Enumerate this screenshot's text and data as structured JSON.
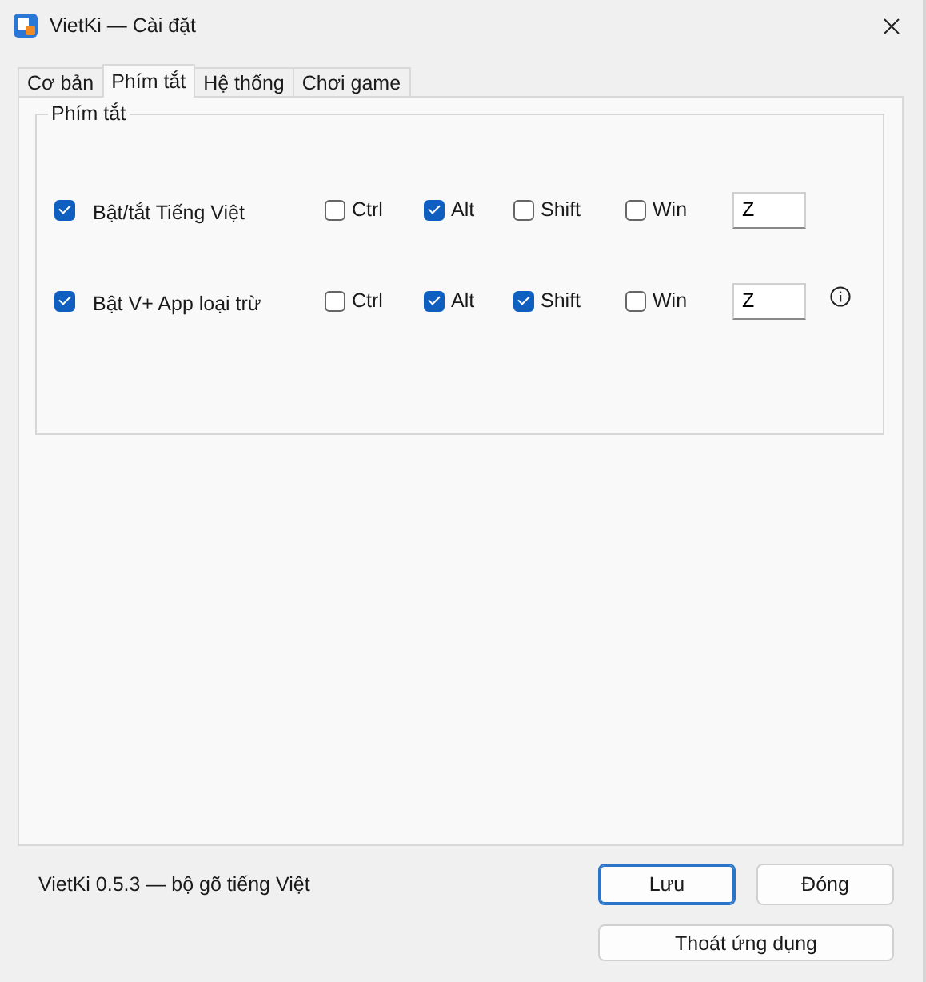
{
  "window": {
    "title": "VietKi — Cài đặt"
  },
  "tabs": [
    {
      "label": "Cơ bản",
      "selected": false
    },
    {
      "label": "Phím tắt",
      "selected": true
    },
    {
      "label": "Hệ thống",
      "selected": false
    },
    {
      "label": "Chơi game",
      "selected": false
    }
  ],
  "group": {
    "title": "Phím tắt"
  },
  "shortcuts": [
    {
      "label": "Bật/tắt Tiếng Việt",
      "enabled": true,
      "modifiers": [
        {
          "label": "Ctrl",
          "checked": false
        },
        {
          "label": "Alt",
          "checked": true
        },
        {
          "label": "Shift",
          "checked": false
        },
        {
          "label": "Win",
          "checked": false
        }
      ],
      "key": "Z",
      "info": false
    },
    {
      "label": "Bật V+ App loại trừ",
      "enabled": true,
      "modifiers": [
        {
          "label": "Ctrl",
          "checked": false
        },
        {
          "label": "Alt",
          "checked": true
        },
        {
          "label": "Shift",
          "checked": true
        },
        {
          "label": "Win",
          "checked": false
        }
      ],
      "key": "Z",
      "info": true
    }
  ],
  "status_text": "VietKi 0.5.3 — bộ gõ tiếng Việt",
  "buttons": [
    {
      "label": "Lưu",
      "kind": "primary"
    },
    {
      "label": "Đóng",
      "kind": "default"
    },
    {
      "label": "Thoát ứng dụng",
      "kind": "wide"
    }
  ]
}
